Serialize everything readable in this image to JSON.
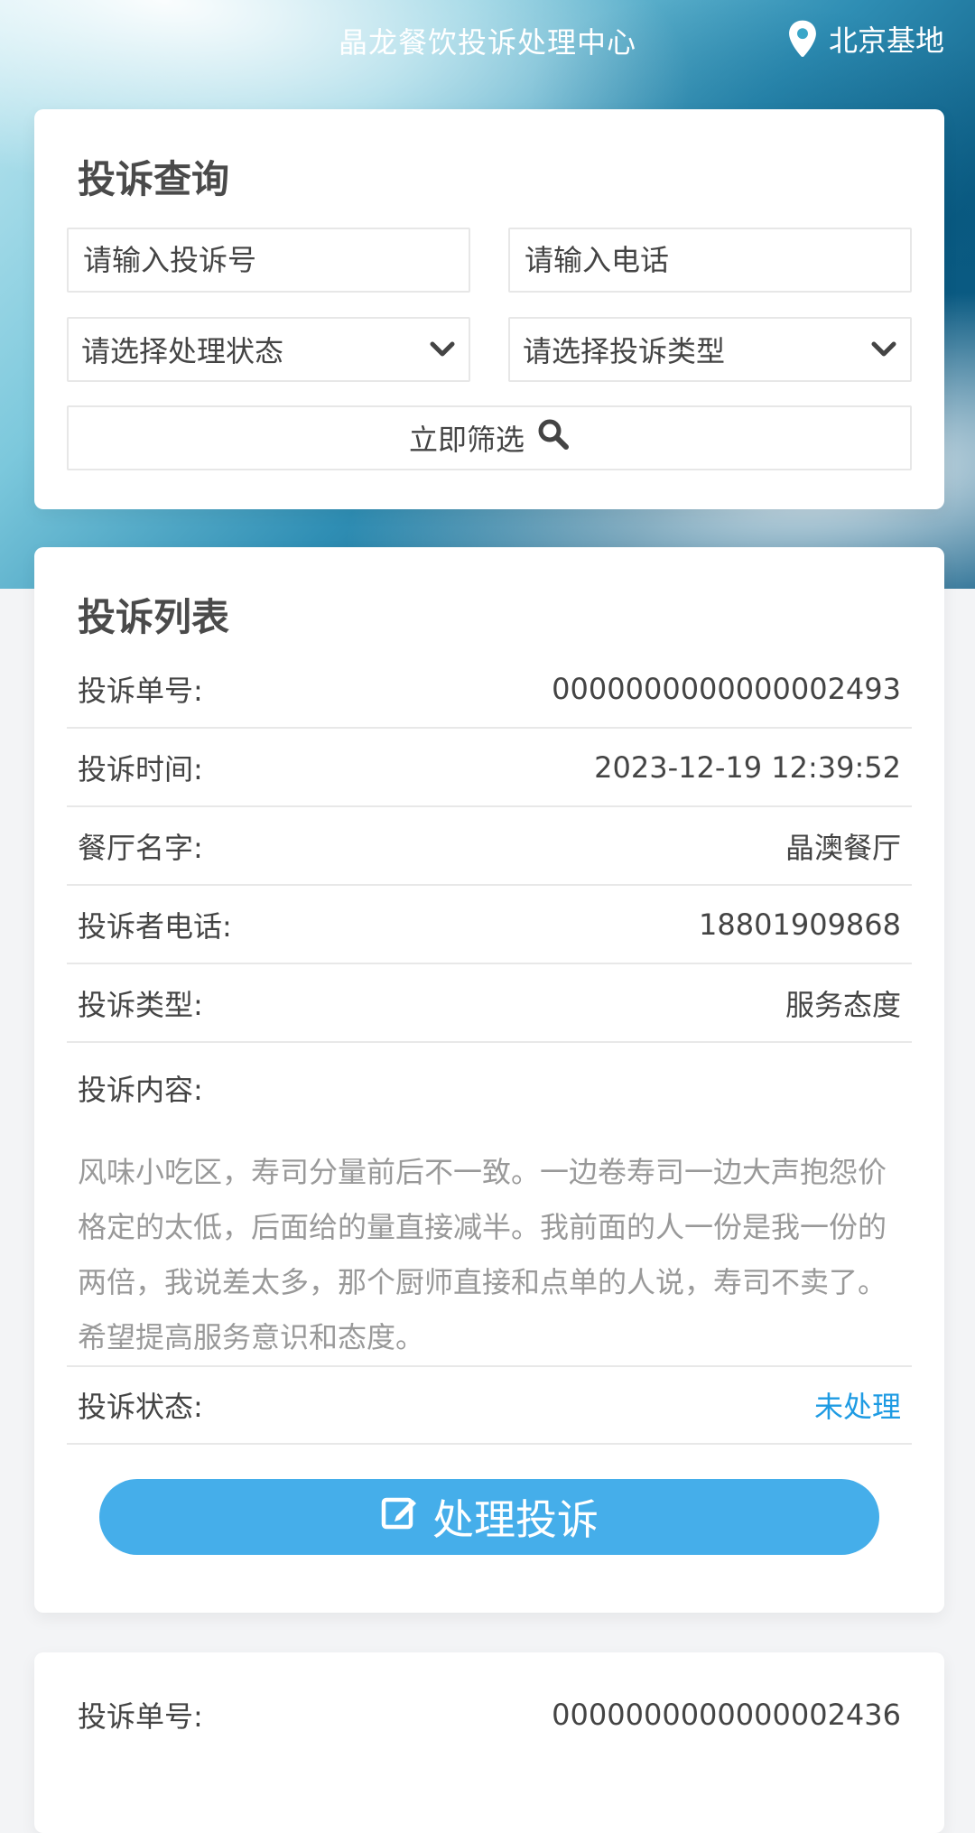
{
  "header": {
    "title": "晶龙餐饮投诉处理中心",
    "location": "北京基地"
  },
  "search": {
    "title": "投诉查询",
    "complaint_no_placeholder": "请输入投诉号",
    "phone_placeholder": "请输入电话",
    "status_select": "请选择处理状态",
    "type_select": "请选择投诉类型",
    "filter_button": "立即筛选"
  },
  "list": {
    "title": "投诉列表",
    "items": [
      {
        "no_label": "投诉单号:",
        "no_value": "0000000000000002493",
        "time_label": "投诉时间:",
        "time_value": "2023-12-19 12:39:52",
        "restaurant_label": "餐厅名字:",
        "restaurant_value": "晶澳餐厅",
        "phone_label": "投诉者电话:",
        "phone_value": "18801909868",
        "type_label": "投诉类型:",
        "type_value": "服务态度",
        "content_label": "投诉内容:",
        "content_value": "风味小吃区，寿司分量前后不一致。一边卷寿司一边大声抱怨价格定的太低，后面给的量直接减半。我前面的人一份是我一份的两倍，我说差太多，那个厨师直接和点单的人说，寿司不卖了。希望提高服务意识和态度。",
        "status_label": "投诉状态:",
        "status_value": "未处理",
        "action_label": "处理投诉"
      },
      {
        "no_label": "投诉单号:",
        "no_value": "0000000000000002436"
      }
    ]
  },
  "colors": {
    "accent": "#45aeea",
    "status_unprocessed": "#1e9be3"
  },
  "icons": {
    "location": "map-pin-icon",
    "chevron": "chevron-down-icon",
    "search": "search-icon",
    "edit": "edit-icon"
  }
}
